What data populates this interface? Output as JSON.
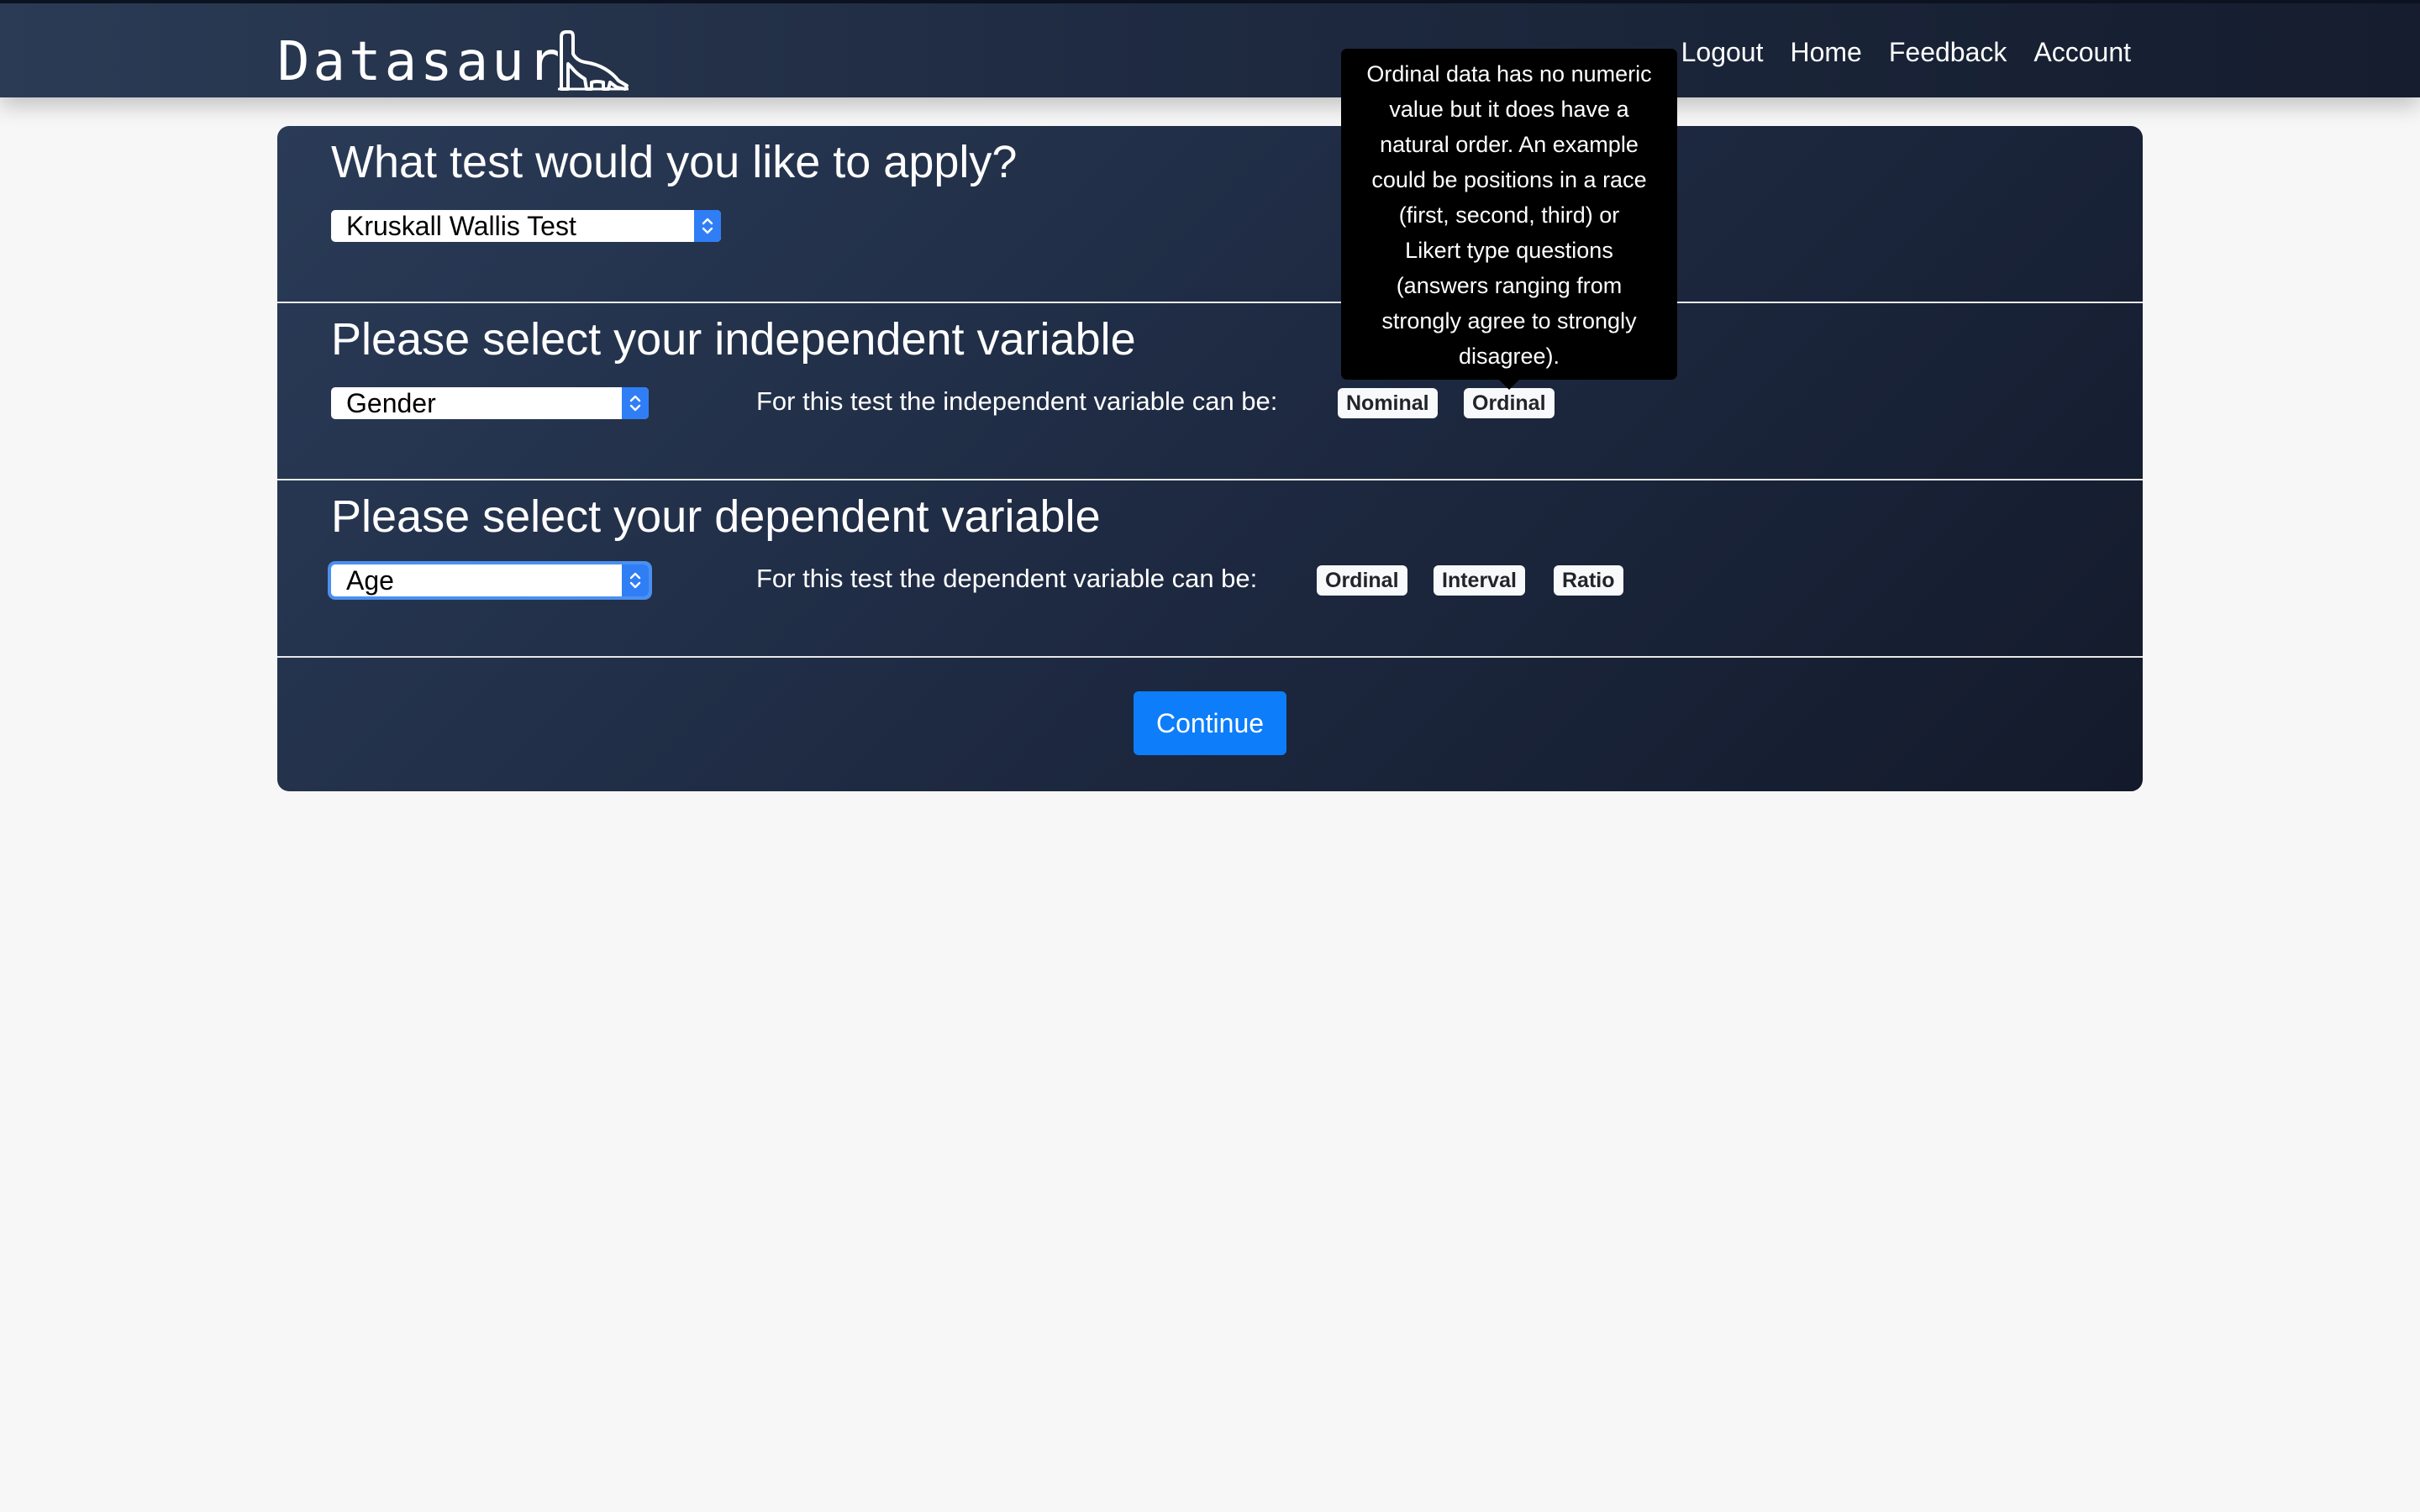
{
  "navbar": {
    "logo_text": "Datasaur",
    "logo_icon": "dinosaur-icon",
    "links": [
      "Logout",
      "Home",
      "Feedback",
      "Account"
    ]
  },
  "test_section": {
    "heading": "What test would you like to apply?",
    "selected": "Kruskall Wallis Test"
  },
  "independent_section": {
    "heading": "Please select your independent variable",
    "selected": "Gender",
    "hint": "For this test the independent variable can be:",
    "badges": [
      "Nominal",
      "Ordinal"
    ]
  },
  "dependent_section": {
    "heading": "Please select your dependent variable",
    "selected": "Age",
    "hint": "For this test the dependent variable can be:",
    "badges": [
      "Ordinal",
      "Interval",
      "Ratio"
    ]
  },
  "continue_label": "Continue",
  "tooltip": {
    "lines": [
      "Ordinal data has no numeric",
      "value but it does have a",
      "natural order. An example",
      "could be positions in a race",
      "(first, second, third) or",
      "Likert type questions",
      "(answers ranging from",
      "strongly agree to strongly",
      "disagree)."
    ]
  },
  "colors": {
    "navbar": "#1f2b42",
    "card": "#1e2a42",
    "primary_button": "#0d7dfa",
    "select_arrow": "#2f7ef5",
    "page_background": "#f7f7f7"
  }
}
